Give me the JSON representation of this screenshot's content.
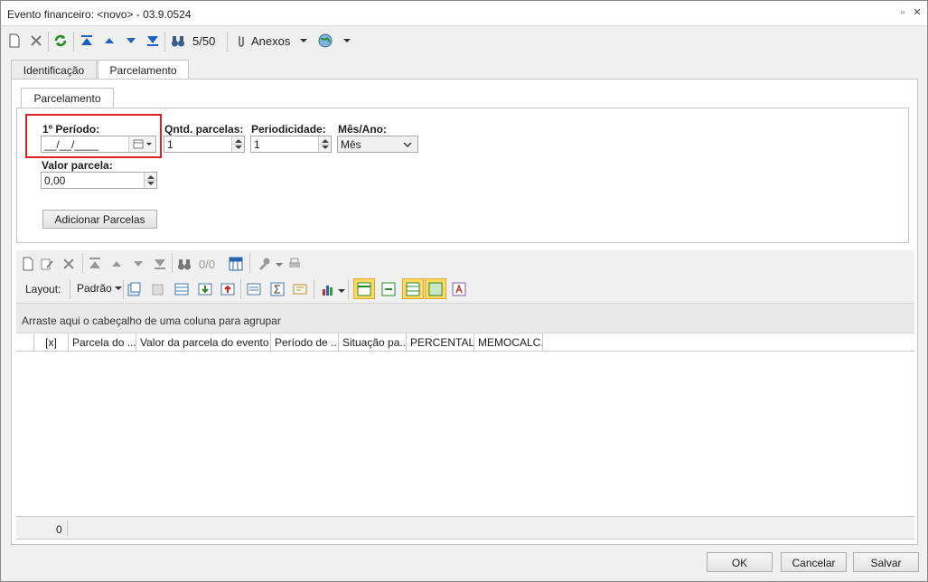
{
  "window": {
    "title": "Evento financeiro: <novo> - 03.9.0524",
    "restore_glyph": "▫",
    "close_glyph": "✕"
  },
  "toolbar": {
    "record_position": "5/50",
    "attachments_label": "Anexos"
  },
  "tabs": [
    {
      "label": "Identificação"
    },
    {
      "label": "Parcelamento"
    }
  ],
  "parcelamento": {
    "tab_label": "Parcelamento",
    "first_period": {
      "label": "1º Período:",
      "value": "__/__/____"
    },
    "installments_qty": {
      "label": "Qntd. parcelas:",
      "value": "1"
    },
    "periodicity": {
      "label": "Periodicidade:",
      "value": "1"
    },
    "month_year": {
      "label": "Mês/Ano:",
      "value": "Mês",
      "options": [
        "Mês"
      ]
    },
    "installment_value": {
      "label": "Valor parcela:",
      "value": "0,00"
    },
    "add_button": "Adicionar Parcelas"
  },
  "grid": {
    "record_position": "0/0",
    "layout_label": "Layout:",
    "layout_value": "Padrão",
    "group_hint": "Arraste aqui o cabeçalho de uma coluna para agrupar",
    "columns": [
      {
        "label": "[x]"
      },
      {
        "label": "Parcela do ..."
      },
      {
        "label": "Valor da parcela do evento"
      },
      {
        "label": "Período de ..."
      },
      {
        "label": "Situação pa..."
      },
      {
        "label": "PERCENTAL..."
      },
      {
        "label": "MEMOCALC..."
      }
    ],
    "footer_count": "0"
  },
  "footer": {
    "ok": "OK",
    "cancel": "Cancelar",
    "save": "Salvar"
  },
  "colors": {
    "highlight": "#e0201f",
    "toggle_active": "#ffd860"
  }
}
